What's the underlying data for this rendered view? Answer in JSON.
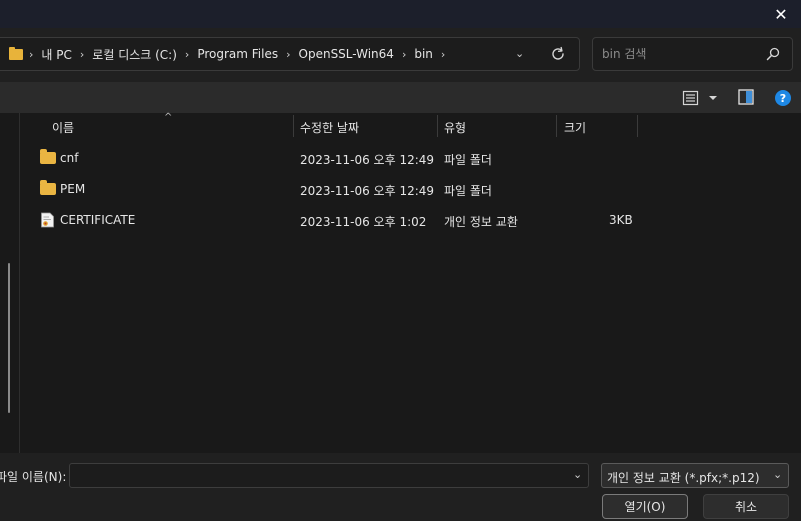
{
  "titlebar": {
    "close_glyph": "✕"
  },
  "address": {
    "folder_icon": "folder-icon",
    "separator": "›",
    "path": [
      "내 PC",
      "로컬 디스크 (C:)",
      "Program Files",
      "OpenSSL-Win64",
      "bin"
    ],
    "dropdown_glyph": "⌄",
    "refresh_icon": "refresh-icon"
  },
  "search": {
    "placeholder": "bin 검색",
    "icon": "search-icon"
  },
  "toolbar": {
    "view_icon": "view-list-icon",
    "preview_icon": "preview-pane-icon",
    "help_label": "?"
  },
  "file_list": {
    "columns": [
      "이름",
      "수정한 날짜",
      "유형",
      "크기"
    ],
    "sort_glyph": "^",
    "rows": [
      {
        "name": "cnf",
        "modified": "2023-11-06 오후 12:49",
        "type": "파일 폴더",
        "size": "",
        "icon": "folder-icon"
      },
      {
        "name": "PEM",
        "modified": "2023-11-06 오후 12:49",
        "type": "파일 폴더",
        "size": "",
        "icon": "folder-icon"
      },
      {
        "name": "CERTIFICATE",
        "modified": "2023-11-06 오후 1:02",
        "type": "개인 정보 교환",
        "size": "3KB",
        "icon": "certificate-icon"
      }
    ]
  },
  "bottom": {
    "filename_label": "파일 이름(N):",
    "filename_value": "",
    "filetype": "개인 정보 교환 (*.pfx;*.p12)",
    "dropdown_glyph": "⌄",
    "open_label": "열기(O)",
    "cancel_label": "취소"
  },
  "colors": {
    "accent": "#1e88e5",
    "folder": "#eab542",
    "background": "#191919"
  }
}
